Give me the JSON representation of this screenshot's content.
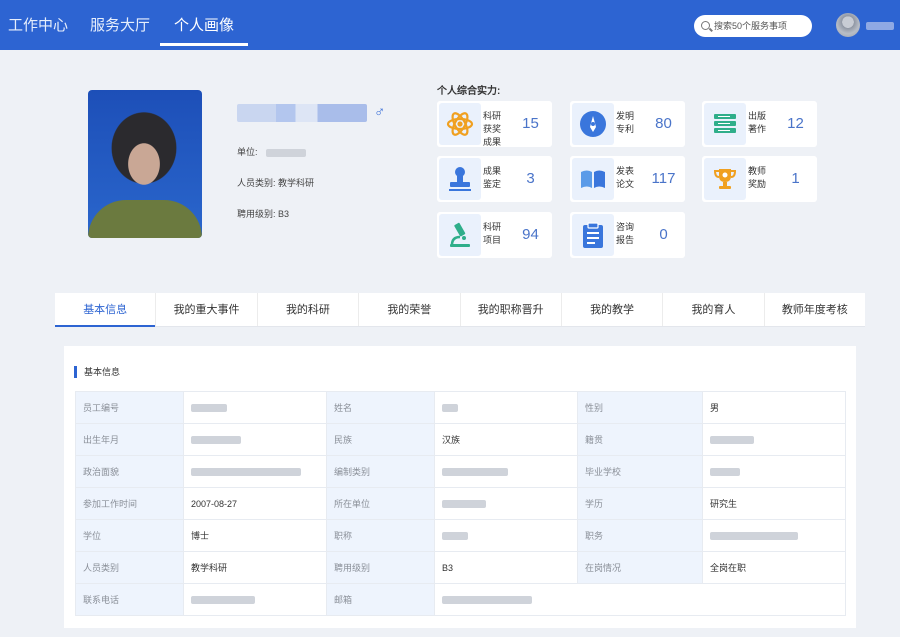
{
  "nav": {
    "items": [
      {
        "label": "工作中心",
        "active": false
      },
      {
        "label": "服务大厅",
        "active": false
      },
      {
        "label": "个人画像",
        "active": true
      }
    ],
    "search_placeholder": "搜索50个服务事项",
    "accent_color": "#2d64d2"
  },
  "profile": {
    "gender_symbol": "♂",
    "unit_label": "单位:",
    "category_label": "人员类别:",
    "category_value": "教学科研",
    "grade_label": "聘用级别:",
    "grade_value": "B3"
  },
  "stats": {
    "title": "个人综合实力:",
    "items": [
      {
        "label": "科研获奖成果",
        "value": "15",
        "icon": "atom-icon"
      },
      {
        "label": "发明专利",
        "value": "80",
        "icon": "compass-icon"
      },
      {
        "label": "出版著作",
        "value": "12",
        "icon": "book-stack-icon"
      },
      {
        "label": "成果鉴定",
        "value": "3",
        "icon": "stamp-icon"
      },
      {
        "label": "发表论文",
        "value": "117",
        "icon": "open-book-icon"
      },
      {
        "label": "教师奖励",
        "value": "1",
        "icon": "trophy-icon"
      },
      {
        "label": "科研项目",
        "value": "94",
        "icon": "microscope-icon"
      },
      {
        "label": "咨询报告",
        "value": "0",
        "icon": "clipboard-icon"
      }
    ]
  },
  "tabs": [
    {
      "label": "基本信息",
      "active": true
    },
    {
      "label": "我的重大事件",
      "active": false
    },
    {
      "label": "我的科研",
      "active": false
    },
    {
      "label": "我的荣誉",
      "active": false
    },
    {
      "label": "我的职称晋升",
      "active": false
    },
    {
      "label": "我的教学",
      "active": false
    },
    {
      "label": "我的育人",
      "active": false
    },
    {
      "label": "教师年度考核",
      "active": false
    }
  ],
  "basic_info": {
    "title": "基本信息",
    "rows": [
      [
        {
          "k": "员工编号",
          "v": ""
        },
        {
          "k": "姓名",
          "v": ""
        },
        {
          "k": "性别",
          "v": "男"
        }
      ],
      [
        {
          "k": "出生年月",
          "v": ""
        },
        {
          "k": "民族",
          "v": "汉族"
        },
        {
          "k": "籍贯",
          "v": ""
        }
      ],
      [
        {
          "k": "政治面貌",
          "v": ""
        },
        {
          "k": "编制类别",
          "v": ""
        },
        {
          "k": "毕业学校",
          "v": ""
        }
      ],
      [
        {
          "k": "参加工作时间",
          "v": "2007-08-27"
        },
        {
          "k": "所在单位",
          "v": ""
        },
        {
          "k": "学历",
          "v": "研究生"
        }
      ],
      [
        {
          "k": "学位",
          "v": "博士"
        },
        {
          "k": "职称",
          "v": ""
        },
        {
          "k": "职务",
          "v": ""
        }
      ],
      [
        {
          "k": "人员类别",
          "v": "教学科研"
        },
        {
          "k": "聘用级别",
          "v": "B3"
        },
        {
          "k": "在岗情况",
          "v": "全岗在职"
        }
      ],
      [
        {
          "k": "联系电话",
          "v": ""
        },
        {
          "k": "邮箱",
          "v": ""
        }
      ]
    ]
  }
}
